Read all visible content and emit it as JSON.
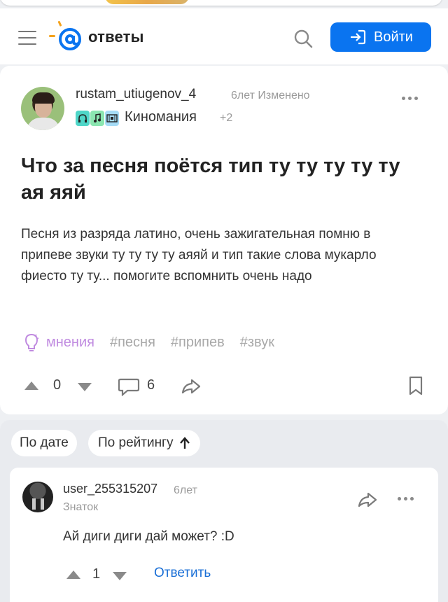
{
  "header": {
    "logo_text": "ответы",
    "login_label": "Войти"
  },
  "question": {
    "author": "rustam_utiugenov_4",
    "time": "6лет Изменено",
    "category": "Киномания",
    "extra_count": "+2",
    "title": "Что за песня поётся тип ту ту ту ту ту ая яяй",
    "body": "Песня из разряда латино, очень зажигательная помню в припеве звуки ту ту ту ту аяяй и тип такие слова мукарло фиесто ту ту... помогите вспомнить очень надо",
    "tags": {
      "ai_label": "мнения",
      "items": [
        "#песня",
        "#припев",
        "#звук"
      ]
    },
    "votes": "0",
    "comments": "6"
  },
  "sort": {
    "by_date": "По дате",
    "by_rating": "По рейтингу"
  },
  "answer": {
    "author": "user_255315207",
    "time": "6лет",
    "rank": "Знаток",
    "text": "Ай диги диги дай может? :D",
    "votes": "1",
    "reply_label": "Ответить"
  },
  "colors": {
    "accent": "#0a74f0",
    "logo_orange": "#f4a21c",
    "ai_tag": "#c08be0",
    "link": "#1a6fd6"
  },
  "icons": [
    "menu-icon",
    "search-icon",
    "login-icon",
    "more-icon",
    "vote-up-icon",
    "vote-down-icon",
    "comments-icon",
    "share-icon",
    "bookmark-icon",
    "lightbulb-icon",
    "arrow-up-icon"
  ]
}
